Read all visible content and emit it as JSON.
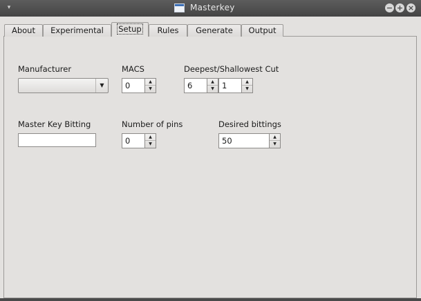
{
  "window": {
    "title": "Masterkey",
    "menu_glyph": "▾",
    "buttons": {
      "minimize": "−",
      "maximize": "+",
      "close": "×"
    }
  },
  "tabs": [
    {
      "label": "About",
      "active": false
    },
    {
      "label": "Experimental",
      "active": false
    },
    {
      "label": "Setup",
      "active": true
    },
    {
      "label": "Rules",
      "active": false
    },
    {
      "label": "Generate",
      "active": false
    },
    {
      "label": "Output",
      "active": false
    }
  ],
  "setup": {
    "manufacturer": {
      "label": "Manufacturer",
      "value": ""
    },
    "macs": {
      "label": "MACS",
      "value": "0"
    },
    "cut": {
      "label": "Deepest/Shallowest Cut",
      "deepest": "6",
      "shallowest": "1"
    },
    "master_key_bitting": {
      "label": "Master Key Bitting",
      "value": ""
    },
    "pins": {
      "label": "Number of pins",
      "value": "0"
    },
    "desired_bittings": {
      "label": "Desired bittings",
      "value": "50"
    }
  },
  "glyphs": {
    "up": "▲",
    "down": "▼",
    "combo_arrow": "▼"
  }
}
